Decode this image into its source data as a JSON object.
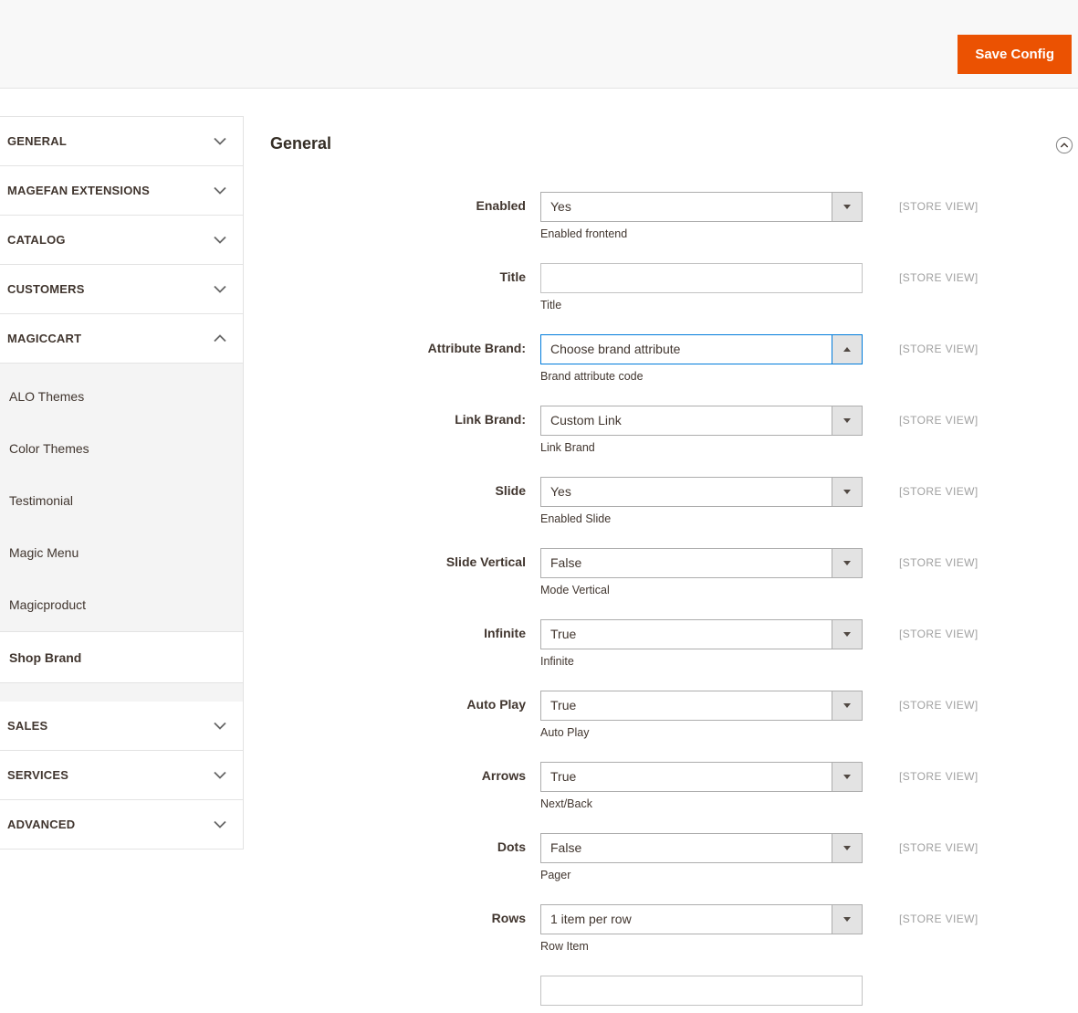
{
  "colors": {
    "accent_orange": "#eb5202",
    "focus_blue": "#007bdb",
    "text_dark": "#41362f",
    "border_gray": "#e3e3e3",
    "input_border": "#adadad",
    "scope_gray": "#a0a0a0",
    "topbar_bg": "#f8f8f8",
    "submenu_bg": "#f4f4f4"
  },
  "topbar": {
    "save_button_label": "Save Config"
  },
  "sidebar": {
    "sections": [
      {
        "label": "GENERAL",
        "expanded": false
      },
      {
        "label": "MAGEFAN EXTENSIONS",
        "expanded": false
      },
      {
        "label": "CATALOG",
        "expanded": false
      },
      {
        "label": "CUSTOMERS",
        "expanded": false
      },
      {
        "label": "MAGICCART",
        "expanded": true,
        "active_item": "Shop Brand",
        "items": [
          "ALO Themes",
          "Color Themes",
          "Testimonial",
          "Magic Menu",
          "Magicproduct",
          "Shop Brand"
        ]
      },
      {
        "label": "SALES",
        "expanded": false
      },
      {
        "label": "SERVICES",
        "expanded": false
      },
      {
        "label": "ADVANCED",
        "expanded": false
      }
    ]
  },
  "main": {
    "section_title": "General",
    "fields": [
      {
        "label": "Enabled",
        "type": "select",
        "value": "Yes",
        "note": "Enabled frontend",
        "scope": "[STORE VIEW]",
        "focused": false
      },
      {
        "label": "Title",
        "type": "text",
        "value": "",
        "note": "Title",
        "scope": "[STORE VIEW]",
        "focused": false
      },
      {
        "label": "Attribute Brand:",
        "type": "select",
        "value": "Choose brand attribute",
        "note": "Brand attribute code",
        "scope": "[STORE VIEW]",
        "focused": true
      },
      {
        "label": "Link Brand:",
        "type": "select",
        "value": "Custom Link",
        "note": "Link Brand",
        "scope": "[STORE VIEW]",
        "focused": false
      },
      {
        "label": "Slide",
        "type": "select",
        "value": "Yes",
        "note": "Enabled Slide",
        "scope": "[STORE VIEW]",
        "focused": false
      },
      {
        "label": "Slide Vertical",
        "type": "select",
        "value": "False",
        "note": "Mode Vertical",
        "scope": "[STORE VIEW]",
        "focused": false
      },
      {
        "label": "Infinite",
        "type": "select",
        "value": "True",
        "note": "Infinite",
        "scope": "[STORE VIEW]",
        "focused": false
      },
      {
        "label": "Auto Play",
        "type": "select",
        "value": "True",
        "note": "Auto Play",
        "scope": "[STORE VIEW]",
        "focused": false
      },
      {
        "label": "Arrows",
        "type": "select",
        "value": "True",
        "note": "Next/Back",
        "scope": "[STORE VIEW]",
        "focused": false
      },
      {
        "label": "Dots",
        "type": "select",
        "value": "False",
        "note": "Pager",
        "scope": "[STORE VIEW]",
        "focused": false
      },
      {
        "label": "Rows",
        "type": "select",
        "value": "1 item per row",
        "note": "Row Item",
        "scope": "[STORE VIEW]",
        "focused": false
      },
      {
        "label": "",
        "type": "text",
        "value": "",
        "note": "",
        "scope": "",
        "focused": false,
        "partial": true
      }
    ]
  }
}
